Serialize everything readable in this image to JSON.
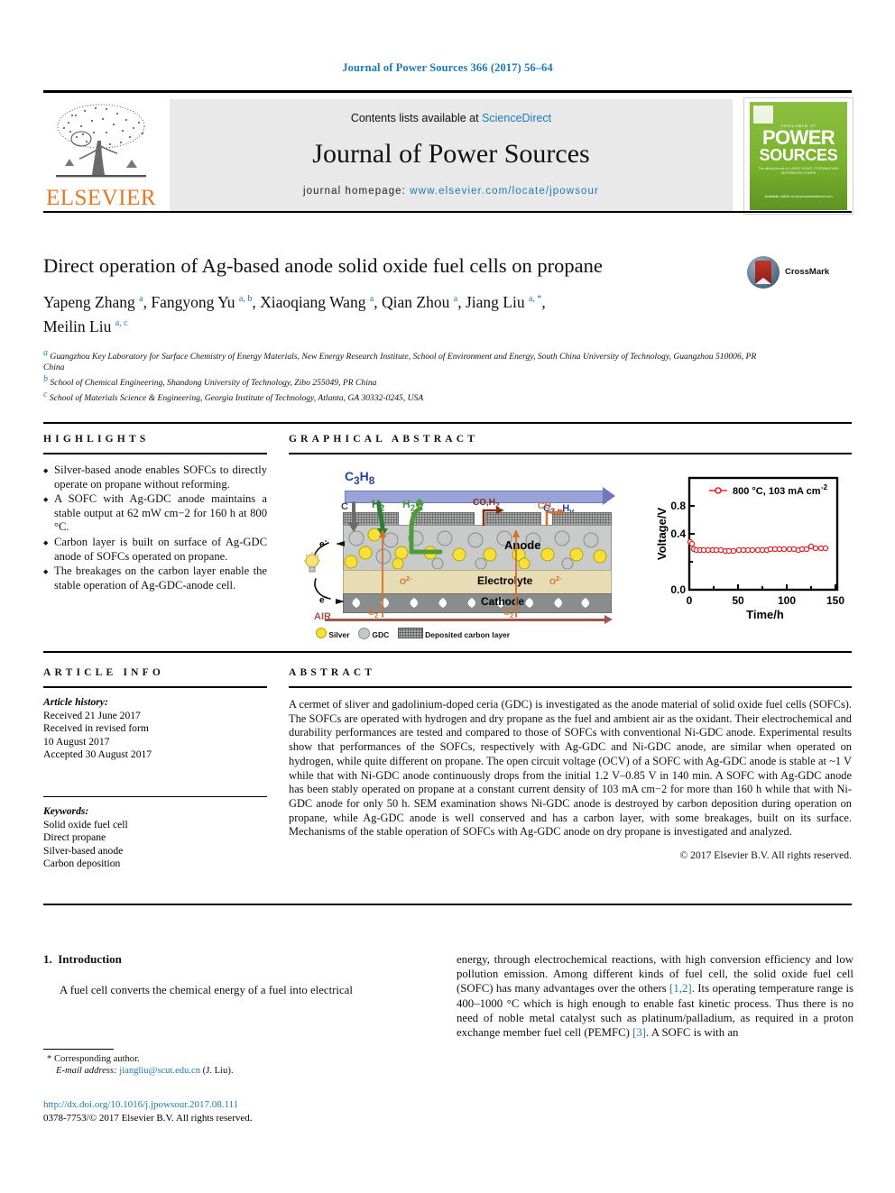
{
  "running_head": "Journal of Power Sources 366 (2017) 56–64",
  "masthead": {
    "contents_prefix": "Contents lists available at ",
    "contents_link": "ScienceDirect",
    "journal_title": "Journal of Power Sources",
    "homepage_label": "journal homepage: ",
    "homepage_url": "www.elsevier.com/locate/jpowsour",
    "publisher_name": "ELSEVIER",
    "cover": {
      "superline": "AVAILABLE AT",
      "line1": "POWER",
      "line2": "SOURCES",
      "tagline": "The official journal for\nLARGE SCALE, PORTABLE AND DISTRIBUTED POWER",
      "footer": "Available online\nat www.sciencedirect.com"
    }
  },
  "article": {
    "title": "Direct operation of Ag-based anode solid oxide fuel cells on propane",
    "crossmark_label": "CrossMark",
    "authors_line1": "Yapeng Zhang a, Fangyong Yu a, b, Xiaoqiang Wang a, Qian Zhou a, Jiang Liu a, *,",
    "authors_line2": "Meilin Liu a, c",
    "authors": [
      {
        "name": "Yapeng Zhang",
        "marks": "a"
      },
      {
        "name": "Fangyong Yu",
        "marks": "a, b"
      },
      {
        "name": "Xiaoqiang Wang",
        "marks": "a"
      },
      {
        "name": "Qian Zhou",
        "marks": "a"
      },
      {
        "name": "Jiang Liu",
        "marks": "a, *"
      },
      {
        "name": "Meilin Liu",
        "marks": "a, c"
      }
    ],
    "affiliations": [
      {
        "mark": "a",
        "text": "Guangzhou Key Laboratory for Surface Chemistry of Energy Materials, New Energy Research Institute, School of Environment and Energy, South China University of Technology, Guangzhou 510006, PR China"
      },
      {
        "mark": "b",
        "text": "School of Chemical Engineering, Shandong University of Technology, Zibo 255049, PR China"
      },
      {
        "mark": "c",
        "text": "School of Materials Science & Engineering, Georgia Institute of Technology, Atlanta, GA 30332-0245, USA"
      }
    ]
  },
  "highlights": {
    "heading": "HIGHLIGHTS",
    "items": [
      "Silver-based anode enables SOFCs to directly operate on propane without reforming.",
      "A SOFC with Ag-GDC anode maintains a stable output at 62 mW cm−2 for 160 h at 800 °C.",
      "Carbon layer is built on surface of Ag-GDC anode of SOFCs operated on propane.",
      "The breakages on the carbon layer enable the stable operation of Ag-GDC-anode cell."
    ]
  },
  "graphical_abstract": {
    "heading": "GRAPHICAL ABSTRACT",
    "schematic": {
      "fuel_in": "C3H8",
      "fuel_out": "C3-xHy",
      "species": [
        "C",
        "H2",
        "H2O",
        "CO,H2",
        "CO"
      ],
      "layers": [
        "Anode",
        "Electrolyte",
        "Cathode"
      ],
      "ion": "O2-",
      "air_label": "AIR",
      "oxygen": "O2",
      "electron": "e-",
      "legend": [
        "Silver",
        "GDC",
        "Deposited carbon layer"
      ]
    },
    "chart_data": {
      "type": "line",
      "title": "",
      "xlabel": "Time/h",
      "ylabel": "Voltage/V",
      "xlim": [
        0,
        155
      ],
      "ylim": [
        0.0,
        0.95
      ],
      "xticks": [
        0,
        50,
        100,
        150
      ],
      "yticks": [
        "0.0",
        "0.4",
        "0.8"
      ],
      "grid": false,
      "legend_position": "top-center",
      "series": [
        {
          "name": "800 °C, 103 mA cm−2",
          "color": "#e8232a",
          "marker": "open-circle",
          "x": [
            1,
            3,
            5,
            8,
            11,
            15,
            20,
            25,
            30,
            35,
            40,
            45,
            49,
            55,
            60,
            65,
            70,
            75,
            80,
            85,
            90,
            95,
            100,
            105,
            110,
            115,
            120,
            125,
            130,
            135,
            140,
            145,
            150
          ],
          "y": [
            0.68,
            0.66,
            0.58,
            0.57,
            0.57,
            0.57,
            0.57,
            0.57,
            0.57,
            0.57,
            0.56,
            0.56,
            0.55,
            0.57,
            0.57,
            0.57,
            0.57,
            0.57,
            0.57,
            0.57,
            0.58,
            0.58,
            0.58,
            0.58,
            0.58,
            0.58,
            0.57,
            0.58,
            0.58,
            0.62,
            0.59,
            0.59,
            0.59
          ]
        }
      ]
    }
  },
  "article_info": {
    "heading": "ARTICLE INFO",
    "history_label": "Article history:",
    "history": [
      "Received 21 June 2017",
      "Received in revised form",
      "10 August 2017",
      "Accepted 30 August 2017"
    ],
    "keywords_label": "Keywords:",
    "keywords": [
      "Solid oxide fuel cell",
      "Direct propane",
      "Silver-based anode",
      "Carbon deposition"
    ]
  },
  "abstract": {
    "heading": "ABSTRACT",
    "text": "A cermet of sliver and gadolinium-doped ceria (GDC) is investigated as the anode material of solid oxide fuel cells (SOFCs). The SOFCs are operated with hydrogen and dry propane as the fuel and ambient air as the oxidant. Their electrochemical and durability performances are tested and compared to those of SOFCs with conventional Ni-GDC anode. Experimental results show that performances of the SOFCs, respectively with Ag-GDC and Ni-GDC anode, are similar when operated on hydrogen, while quite different on propane. The open circuit voltage (OCV) of a SOFC with Ag-GDC anode is stable at ~1 V while that with Ni-GDC anode continuously drops from the initial 1.2 V–0.85 V in 140 min. A SOFC with Ag-GDC anode has been stably operated on propane at a constant current density of 103 mA cm−2 for more than 160 h while that with Ni-GDC anode for only 50 h. SEM examination shows Ni-GDC anode is destroyed by carbon deposition during operation on propane, while Ag-GDC anode is well conserved and has a carbon layer, with some breakages, built on its surface. Mechanisms of the stable operation of SOFCs with Ag-GDC anode on dry propane is investigated and analyzed.",
    "copyright": "© 2017 Elsevier B.V. All rights reserved."
  },
  "body": {
    "section_number": "1.",
    "section_title": "Introduction",
    "left_paragraph": "A fuel cell converts the chemical energy of a fuel into electrical",
    "right_paragraph_part1": "energy, through electrochemical reactions, with high conversion efficiency and low pollution emission. Among different kinds of fuel cell, the solid oxide fuel cell (SOFC) has many advantages over the others ",
    "ref_1_2": "[1,2]",
    "right_paragraph_part2": ". Its operating temperature range is 400–1000 °C which is high enough to enable fast kinetic process. Thus there is no need of noble metal catalyst such as platinum/palladium, as required in a proton exchange member fuel cell (PEMFC) ",
    "ref_3": "[3]",
    "right_paragraph_part3": ". A SOFC is with an"
  },
  "footer": {
    "corresponding_marker": "*",
    "corresponding_label": "Corresponding author.",
    "email_label": "E-mail address:",
    "email": "jiangliu@scut.edu.cn",
    "email_suffix": "(J. Liu).",
    "doi_link": "http://dx.doi.org/10.1016/j.jpowsour.2017.08.111",
    "issn_line": "0378-7753/© 2017 Elsevier B.V. All rights reserved."
  }
}
